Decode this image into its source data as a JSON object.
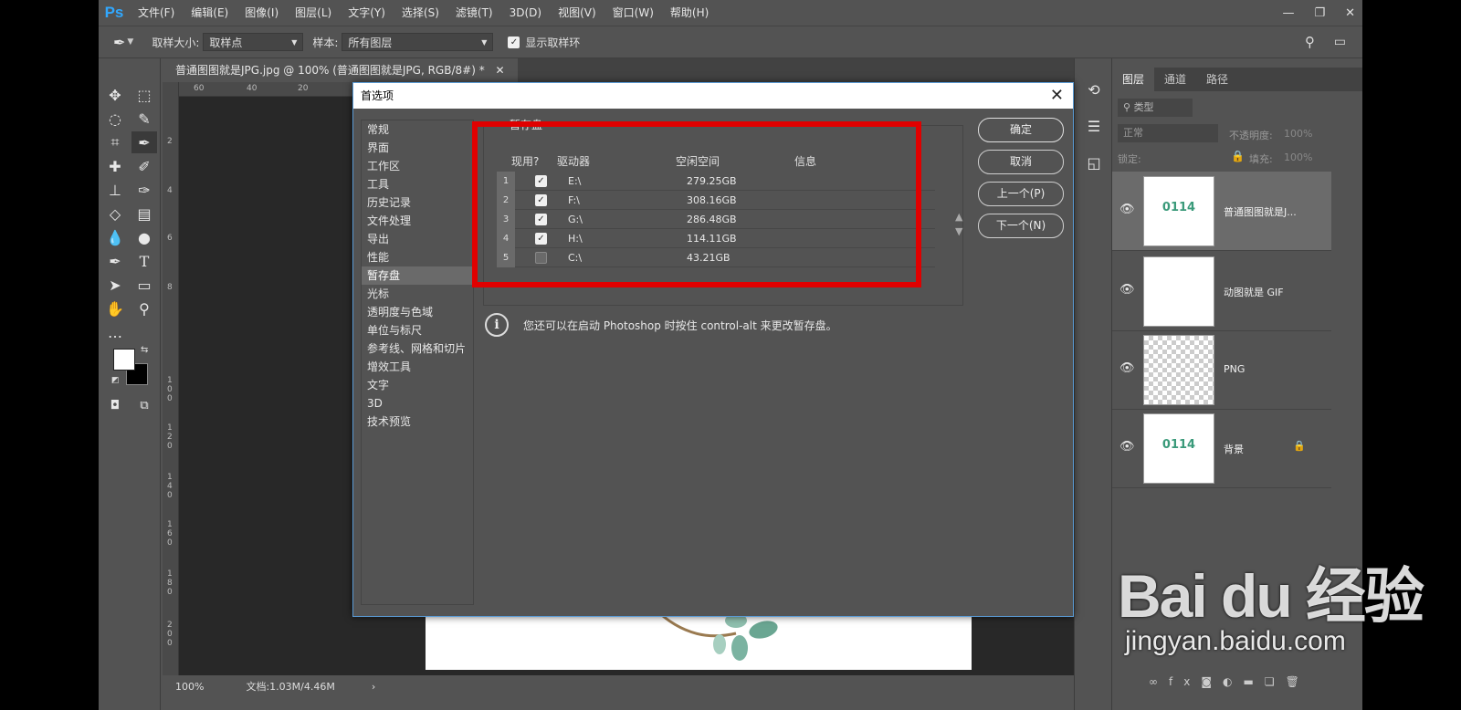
{
  "menubar": {
    "logo": "Ps",
    "items": [
      "文件(F)",
      "编辑(E)",
      "图像(I)",
      "图层(L)",
      "文字(Y)",
      "选择(S)",
      "滤镜(T)",
      "3D(D)",
      "视图(V)",
      "窗口(W)",
      "帮助(H)"
    ],
    "window_controls": [
      "—",
      "❐",
      "✕"
    ]
  },
  "options_bar": {
    "sample_size_label": "取样大小:",
    "sample_size_value": "取样点",
    "sample_label": "样本:",
    "sample_value": "所有图层",
    "show_ring_label": "显示取样环"
  },
  "document": {
    "tab_title": "普通图图就是JPG.jpg @ 100% (普通图图就是JPG, RGB/8#) *",
    "ruler_top": [
      "60",
      "40",
      "20"
    ],
    "ruler_left": [
      "2",
      "4",
      "6",
      "8",
      "1 0 0",
      "1 2 0",
      "1 4 0",
      "1 6 0",
      "1 8 0",
      "2 0 0"
    ],
    "zoom": "100%",
    "doc_size": "文档:1.03M/4.46M"
  },
  "layers_panel": {
    "tabs": [
      "图层",
      "通道",
      "路径"
    ],
    "filter_label": "类型",
    "blend_mode": "正常",
    "opacity_label": "不透明度:",
    "opacity_value": "100%",
    "lock_label": "锁定:",
    "fill_label": "填充:",
    "fill_value": "100%",
    "thumb_text": "0114",
    "layers": [
      {
        "name": "普通图图就是J...",
        "selected": true
      },
      {
        "name": "动图就是 GIF",
        "selected": false
      },
      {
        "name": "PNG",
        "selected": false
      },
      {
        "name": "背景",
        "selected": false,
        "locked": true
      }
    ]
  },
  "dialog": {
    "title": "首选项",
    "nav": [
      "常规",
      "界面",
      "工作区",
      "工具",
      "历史记录",
      "文件处理",
      "导出",
      "性能",
      "暂存盘",
      "光标",
      "透明度与色域",
      "单位与标尺",
      "参考线、网格和切片",
      "增效工具",
      "文字",
      "3D",
      "技术预览"
    ],
    "nav_selected": 8,
    "group_label": "暂存盘",
    "columns": {
      "active": "现用?",
      "drive": "驱动器",
      "free": "空闲空间",
      "info": "信息"
    },
    "disks": [
      {
        "num": "1",
        "drive": "E:\\",
        "free": "279.25GB",
        "checked": true
      },
      {
        "num": "2",
        "drive": "F:\\",
        "free": "308.16GB",
        "checked": true
      },
      {
        "num": "3",
        "drive": "G:\\",
        "free": "286.48GB",
        "checked": true
      },
      {
        "num": "4",
        "drive": "H:\\",
        "free": "114.11GB",
        "checked": true
      },
      {
        "num": "5",
        "drive": "C:\\",
        "free": "43.21GB",
        "checked": false
      }
    ],
    "info_text": "您还可以在启动 Photoshop 时按住 control-alt 来更改暂存盘。",
    "buttons": {
      "ok": "确定",
      "cancel": "取消",
      "prev": "上一个(P)",
      "next": "下一个(N)"
    }
  },
  "watermark": {
    "logo": "Bai du 经验",
    "url": "jingyan.baidu.com"
  },
  "colors": {
    "highlight_box": "#e00000",
    "ps_blue": "#31a8ff"
  }
}
